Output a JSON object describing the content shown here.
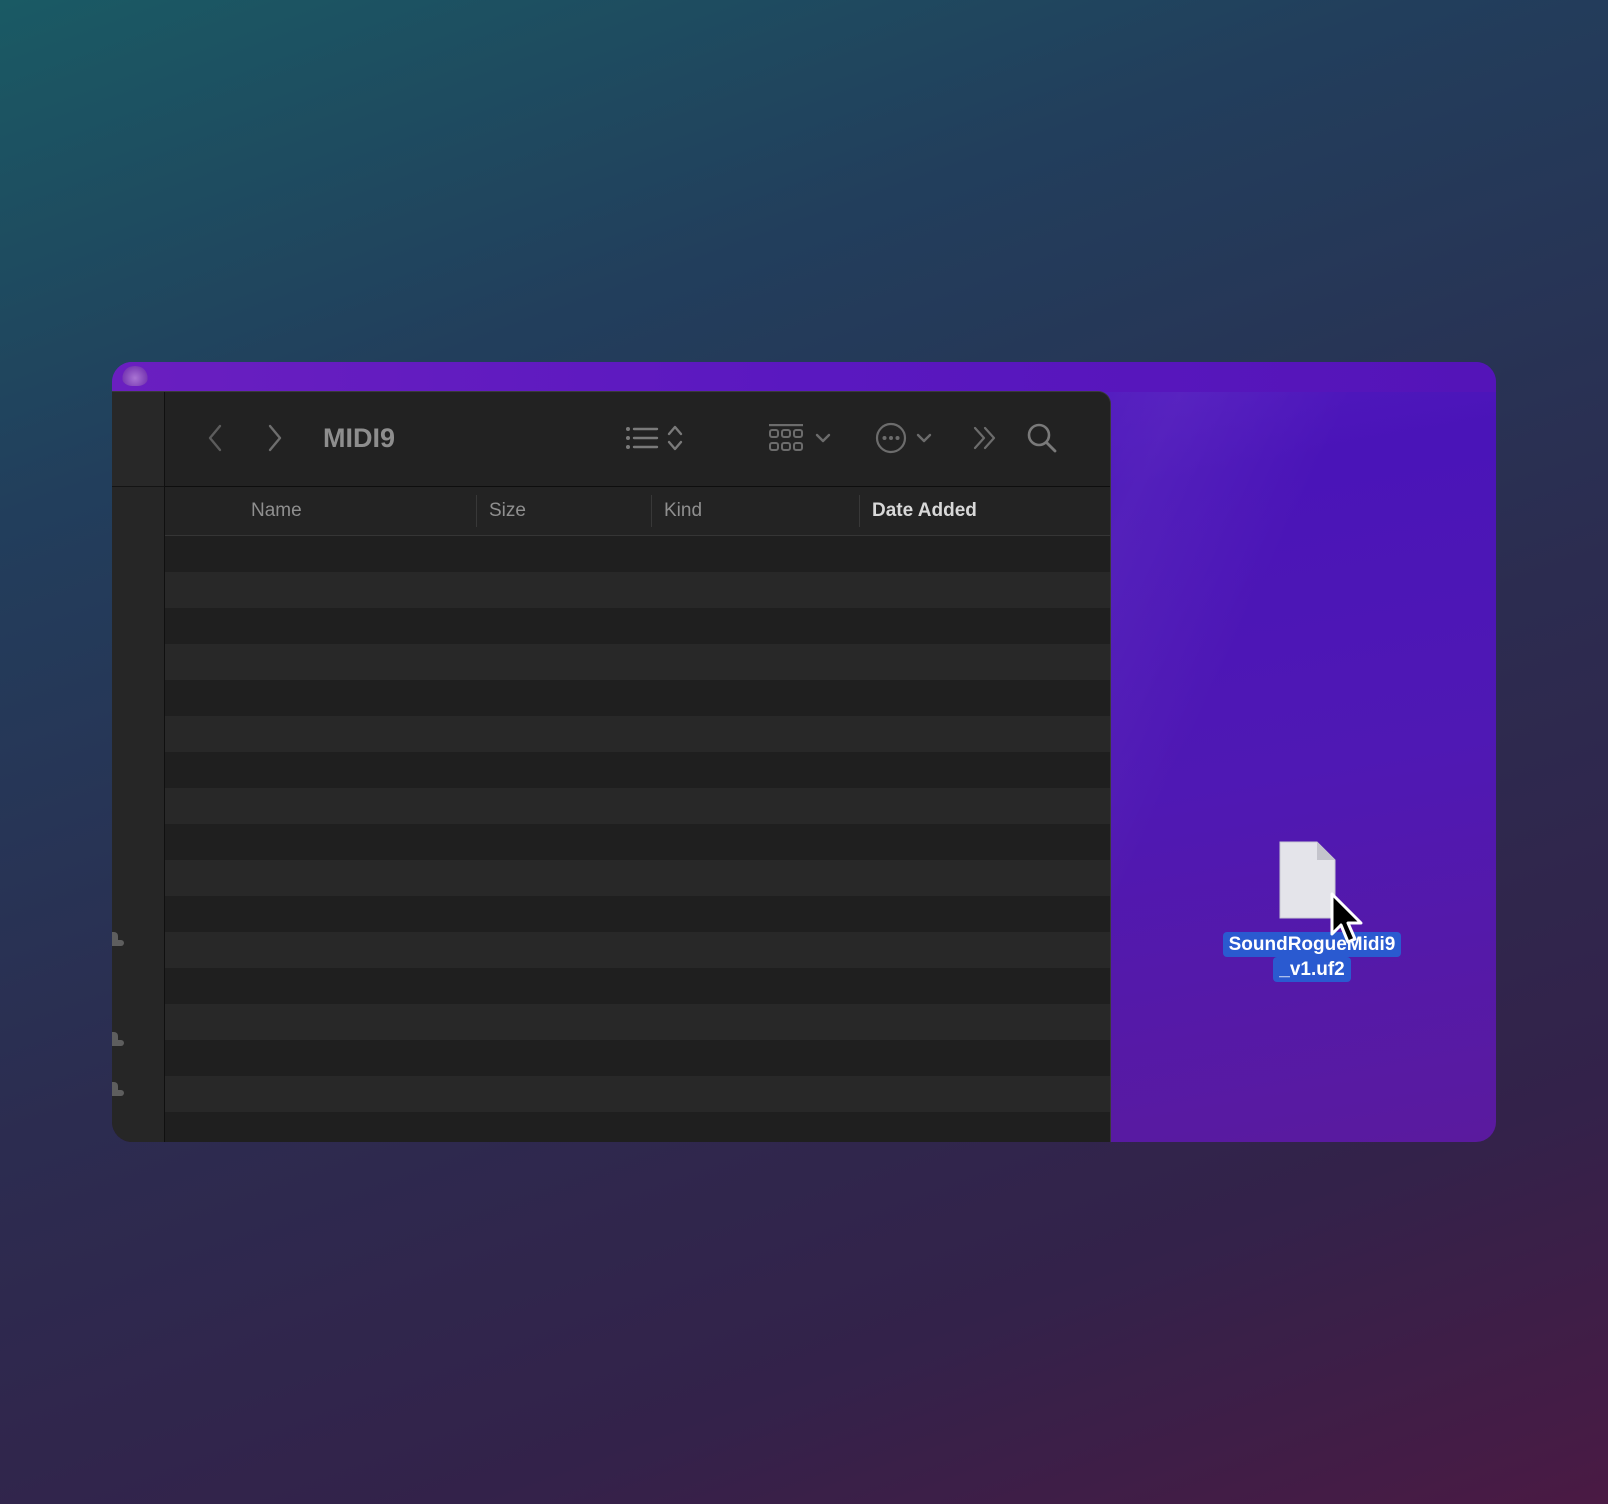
{
  "finder": {
    "title": "MIDI9",
    "columns": {
      "name": "Name",
      "size": "Size",
      "kind": "Kind",
      "date_added": "Date Added"
    },
    "sorted_column": "Date Added",
    "rows": []
  },
  "toolbar": {
    "back_icon": "chevron-left-icon",
    "forward_icon": "chevron-right-icon",
    "view_icon": "list-view-icon",
    "group_icon": "grid-group-icon",
    "action_icon": "ellipsis-circle-icon",
    "overflow_icon": "double-chevron-right-icon",
    "search_icon": "search-icon"
  },
  "desktop": {
    "file": {
      "label_line1": "SoundRogueMidi9",
      "label_line2": "_v1.uf2",
      "selected": true
    }
  },
  "colors": {
    "selection": "#2a5ad0",
    "wallpaper_purple": "#4a14b8",
    "window_bg": "#1e1e1e"
  }
}
